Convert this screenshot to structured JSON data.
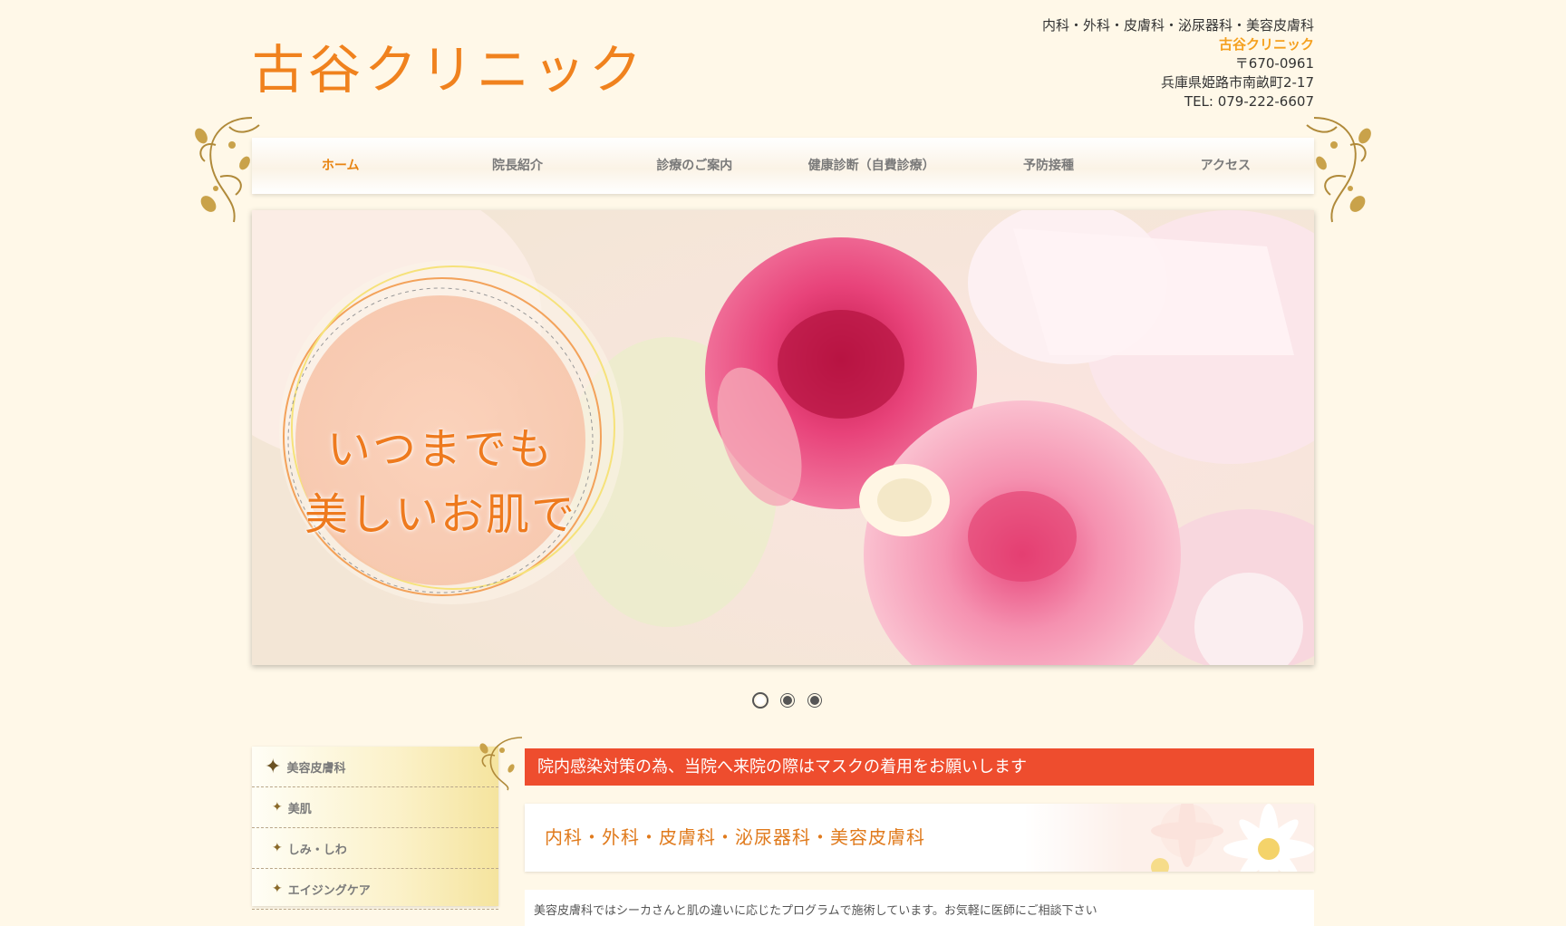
{
  "header": {
    "logo": "古谷クリニック",
    "departments": "内科・外科・皮膚科・泌尿器科・美容皮膚科",
    "clinic_name": "古谷クリニック",
    "postal": "〒670-0961",
    "address": "兵庫県姫路市南畝町2-17",
    "tel": "TEL: 079-222-6607"
  },
  "nav": {
    "items": [
      {
        "label": "ホーム"
      },
      {
        "label": "院長紹介"
      },
      {
        "label": "診療のご案内"
      },
      {
        "label": "健康診断（自費診療）"
      },
      {
        "label": "予防接種"
      },
      {
        "label": "アクセス"
      }
    ]
  },
  "hero": {
    "line1": "いつまでも",
    "line2": "美しいお肌で",
    "slide_count": 3,
    "active_slide": 1
  },
  "sidebar": {
    "title": "美容皮膚科",
    "items": [
      {
        "label": "美肌"
      },
      {
        "label": "しみ・しわ"
      },
      {
        "label": "エイジングケア"
      }
    ]
  },
  "main": {
    "notice": "院内感染対策の為、当院へ来院の際はマスクの着用をお願いします",
    "section_title": "内科・外科・皮膚科・泌尿器科・美容皮膚科",
    "intro_text": "美容皮膚科ではシーカさんと肌の違いに応じたプログラムで施術しています。お気軽に医師にご相談下さい"
  },
  "colors": {
    "background": "#fff8e8",
    "accent_orange": "#f0821e",
    "notice_red": "#ee4d2e",
    "nav_active": "#e8830f"
  }
}
